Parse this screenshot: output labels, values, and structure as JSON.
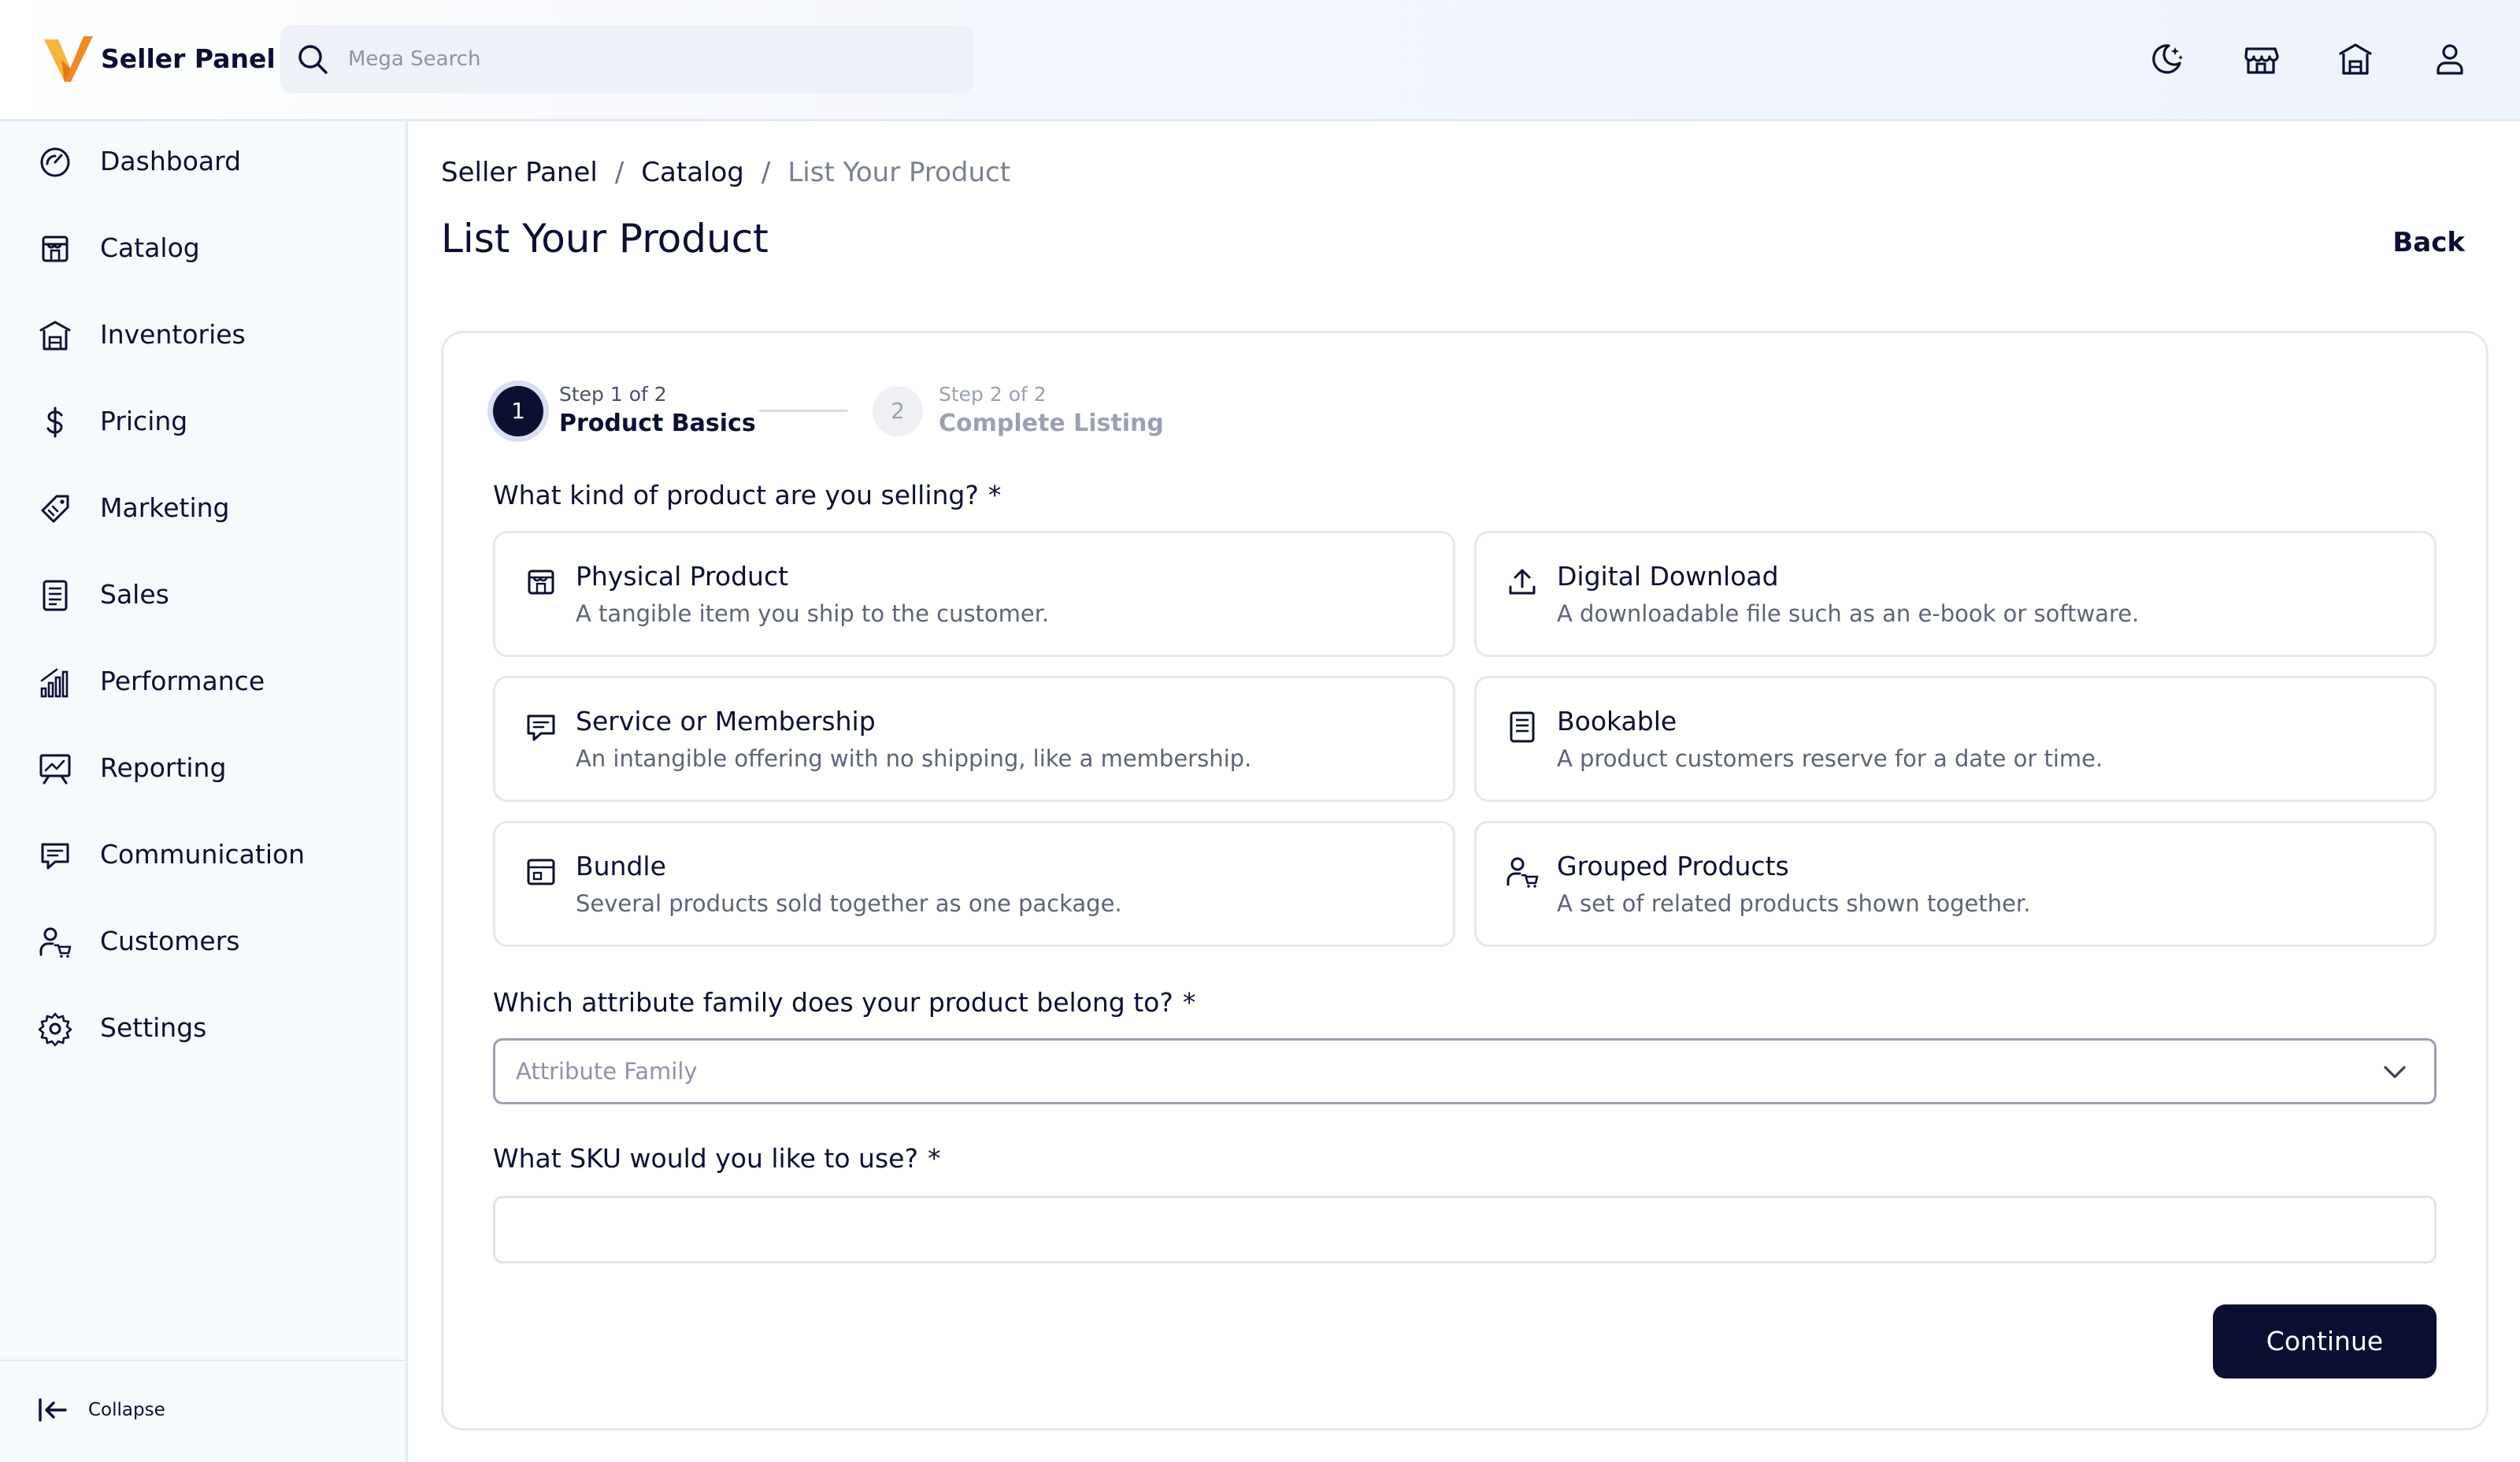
{
  "app": {
    "brand": "Seller Panel",
    "accent": "#0b1033",
    "logo_colors": [
      "#f7b53c",
      "#f08a24"
    ]
  },
  "search": {
    "placeholder": "Mega Search"
  },
  "topbar_icons": [
    "moon-stars-icon",
    "storefront-icon",
    "building-icon",
    "user-icon"
  ],
  "sidebar": {
    "items": [
      {
        "label": "Dashboard",
        "icon": "gauge-icon"
      },
      {
        "label": "Catalog",
        "icon": "storefront-icon"
      },
      {
        "label": "Inventories",
        "icon": "building-icon"
      },
      {
        "label": "Pricing",
        "icon": "dollar-icon"
      },
      {
        "label": "Marketing",
        "icon": "tag-icon"
      },
      {
        "label": "Sales",
        "icon": "receipt-icon"
      },
      {
        "label": "Performance",
        "icon": "signal-bars-icon"
      },
      {
        "label": "Reporting",
        "icon": "presentation-chart-icon"
      },
      {
        "label": "Communication",
        "icon": "chat-icon"
      },
      {
        "label": "Customers",
        "icon": "customer-cart-icon"
      },
      {
        "label": "Settings",
        "icon": "gear-icon"
      }
    ],
    "collapse_label": "Collapse"
  },
  "breadcrumb": {
    "items": [
      "Seller Panel",
      "Catalog",
      "List Your Product"
    ],
    "separator": "/"
  },
  "page": {
    "title": "List Your Product",
    "back_label": "Back"
  },
  "stepper": {
    "steps": [
      {
        "number": "1",
        "caption": "Step 1 of 2",
        "title": "Product Basics",
        "state": "active"
      },
      {
        "number": "2",
        "caption": "Step 2 of 2",
        "title": "Complete Listing",
        "state": "inactive"
      }
    ]
  },
  "form": {
    "q_type": "What kind of product are you selling?",
    "required_mark": "*",
    "product_types": [
      {
        "title": "Physical Product",
        "desc": "A tangible item you ship to the customer.",
        "icon": "box-icon"
      },
      {
        "title": "Digital Download",
        "desc": "A downloadable file such as an e-book or software.",
        "icon": "upload-icon"
      },
      {
        "title": "Service or Membership",
        "desc": "An intangible offering with no shipping, like a membership.",
        "icon": "chat-icon"
      },
      {
        "title": "Bookable",
        "desc": "A product customers reserve for a date or time.",
        "icon": "document-icon"
      },
      {
        "title": "Bundle",
        "desc": "Several products sold together as one package.",
        "icon": "window-icon"
      },
      {
        "title": "Grouped Products",
        "desc": "A set of related products shown together.",
        "icon": "customer-cart-icon"
      }
    ],
    "q_family": "Which attribute family does your product belong to?",
    "family_placeholder": "Attribute Family",
    "q_sku": "What SKU would you like to use?",
    "sku_value": "",
    "continue_label": "Continue"
  }
}
